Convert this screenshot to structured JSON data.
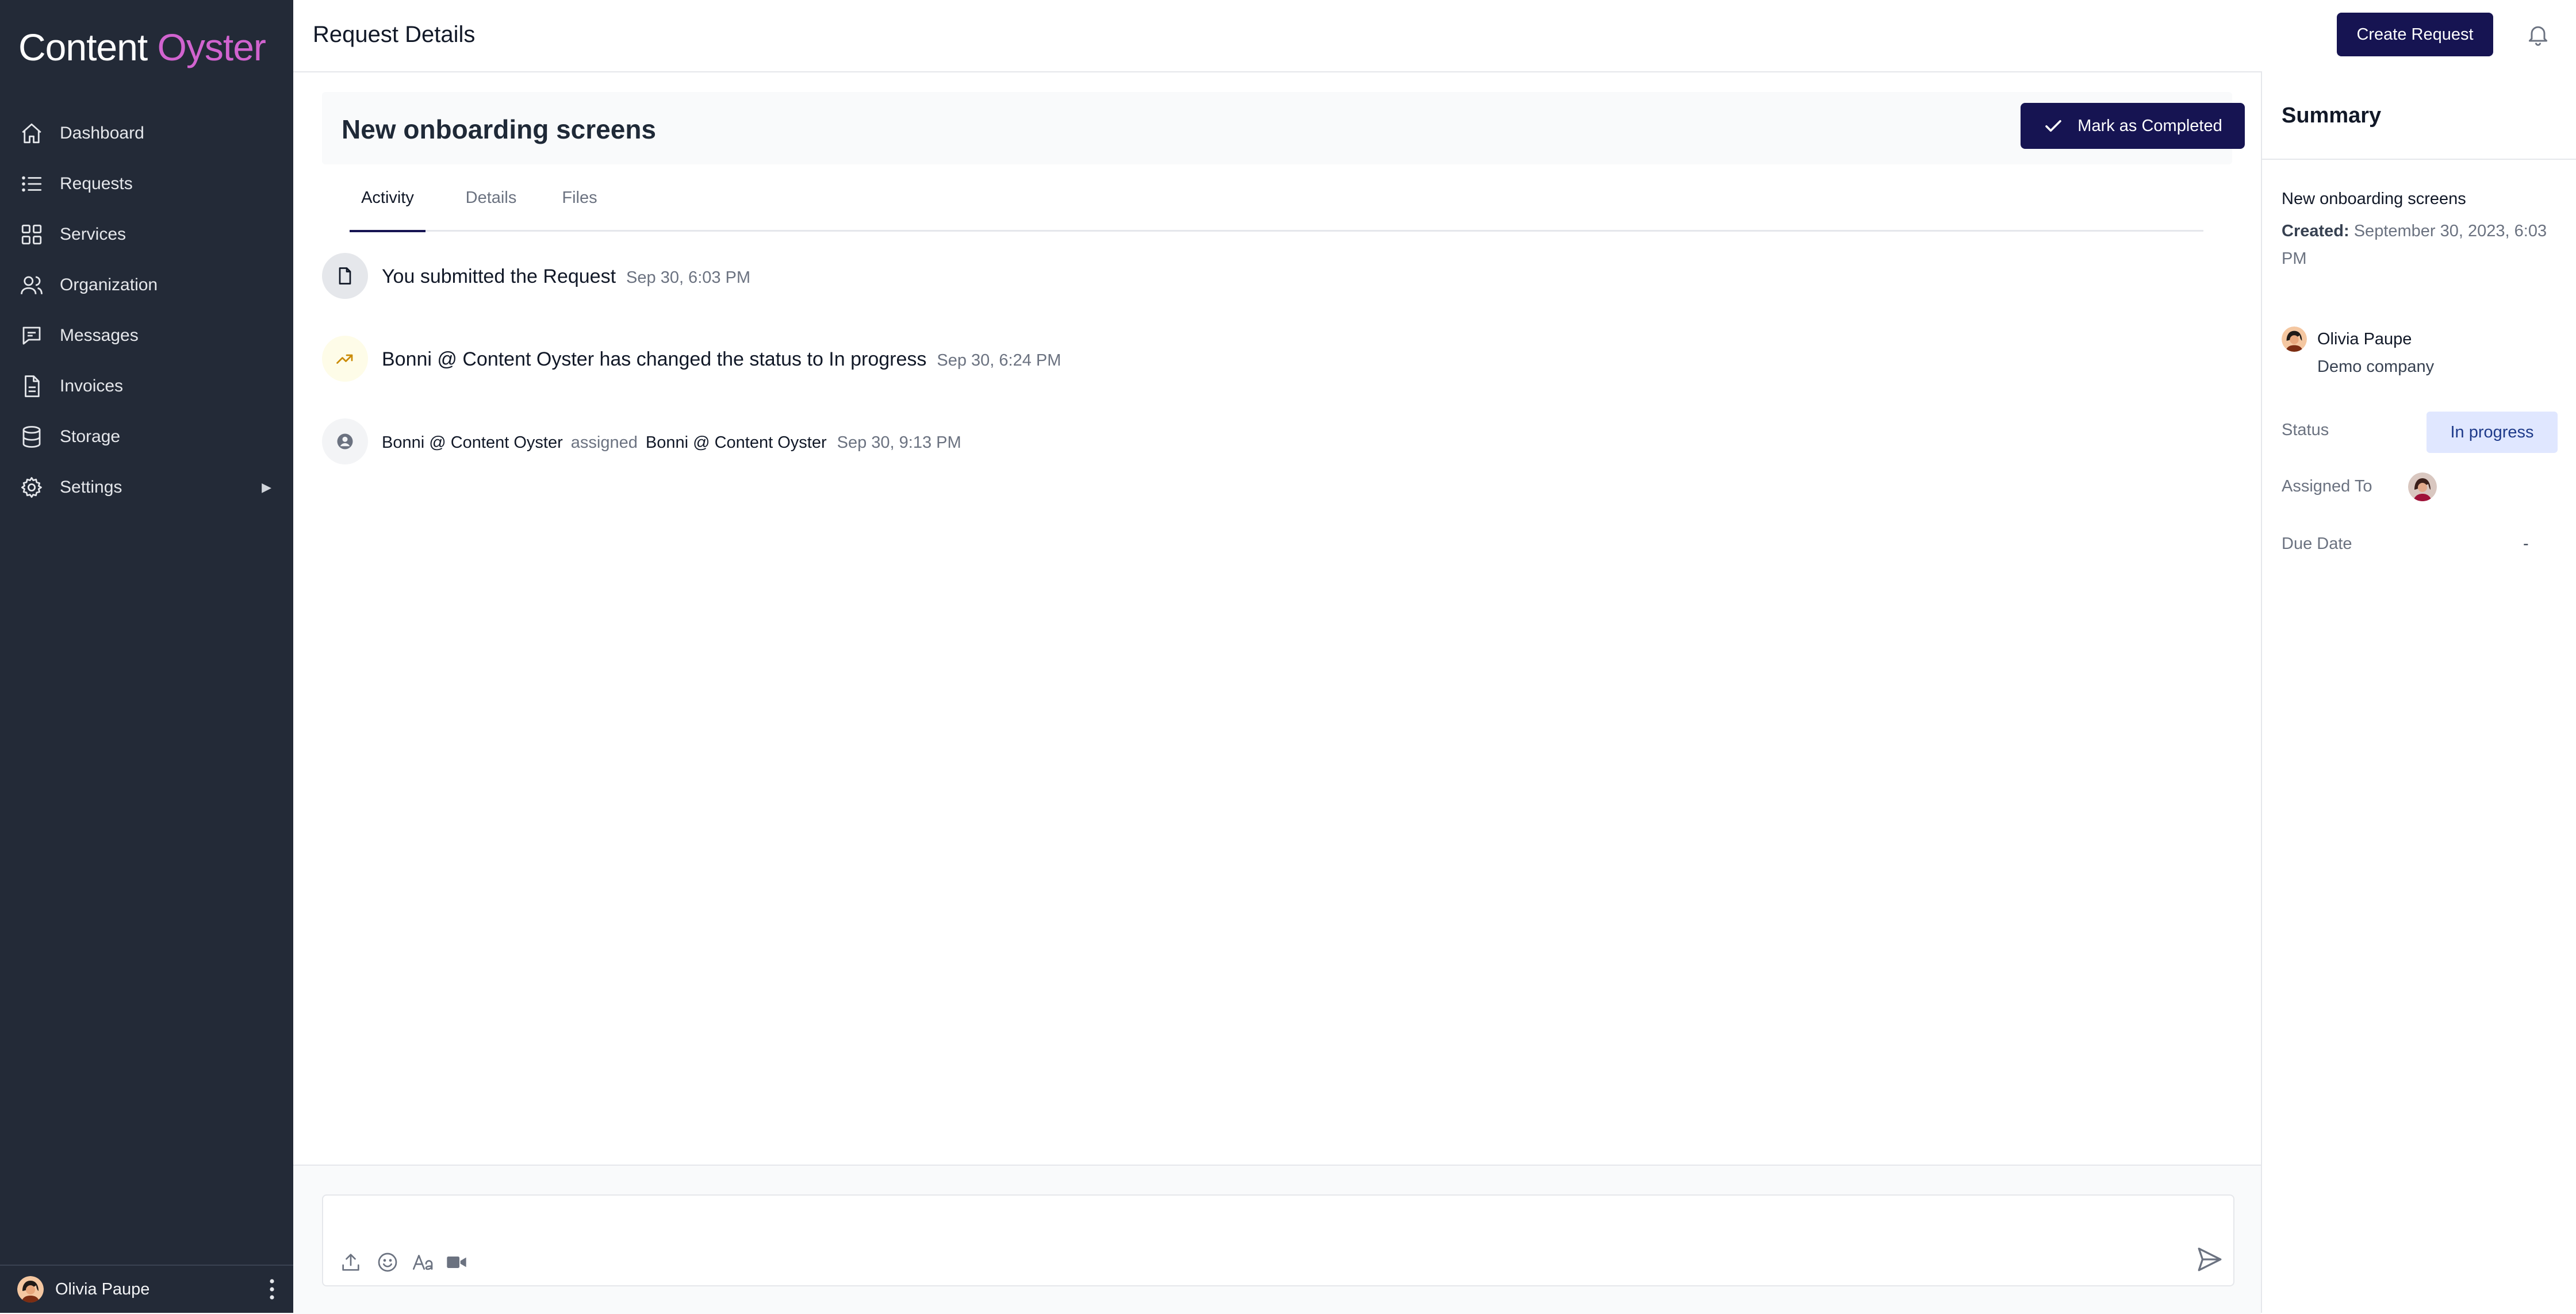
{
  "app": {
    "logo_part1": "Content",
    "logo_part2": "Oyster",
    "accent": "#161452",
    "sidebar_bg": "#232a37",
    "logo_accent": "#d163cf"
  },
  "sidebar": {
    "items": [
      {
        "label": "Dashboard",
        "icon": "home-icon"
      },
      {
        "label": "Requests",
        "icon": "list-icon"
      },
      {
        "label": "Services",
        "icon": "grid-icon"
      },
      {
        "label": "Organization",
        "icon": "users-icon"
      },
      {
        "label": "Messages",
        "icon": "chat-icon"
      },
      {
        "label": "Invoices",
        "icon": "document-icon"
      },
      {
        "label": "Storage",
        "icon": "database-icon"
      },
      {
        "label": "Settings",
        "icon": "gear-icon",
        "arrow": "▶"
      }
    ],
    "user_name": "Olivia Paupe"
  },
  "topbar": {
    "title": "Request Details",
    "create_label": "Create Request"
  },
  "request": {
    "title": "New onboarding screens",
    "complete_label": "Mark as Completed",
    "tabs": [
      "Activity",
      "Details",
      "Files"
    ],
    "active_tab": "Activity"
  },
  "activity": [
    {
      "icon": "document-icon",
      "text": "You submitted the Request",
      "time": "Sep 30, 6:03 PM"
    },
    {
      "icon": "trending-up-icon",
      "text": "Bonni @ Content Oyster has changed the status to In progress",
      "time": "Sep 30, 6:24 PM"
    },
    {
      "icon": "user-circle-icon",
      "actor": "Bonni @ Content Oyster",
      "verb": "assigned",
      "target": "Bonni @ Content Oyster",
      "time": "Sep 30, 9:13 PM"
    }
  ],
  "composer": {
    "placeholder": ""
  },
  "summary": {
    "title": "Summary",
    "request_name": "New onboarding screens",
    "created_label": "Created:",
    "created_value": "September 30, 2023, 6:03 PM",
    "client_name": "Olivia Paupe",
    "client_company": "Demo company",
    "status_label": "Status",
    "status_value": "In progress",
    "assigned_label": "Assigned To",
    "due_label": "Due Date",
    "due_value": "-"
  }
}
